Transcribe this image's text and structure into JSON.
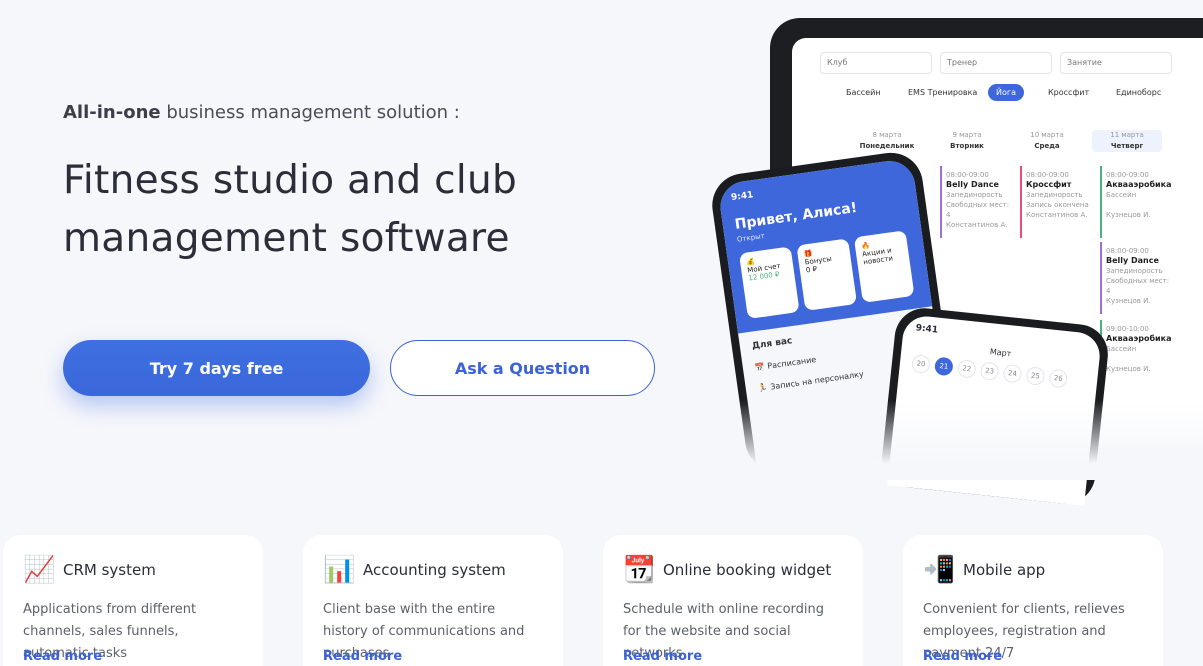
{
  "hero": {
    "eyebrow_bold": "All-in-one",
    "eyebrow_rest": " business management solution :",
    "headline_line1": "Fitness studio and club",
    "headline_line2": "management software",
    "primary_cta": "Try 7 days free",
    "secondary_cta": "Ask a Question"
  },
  "tablet": {
    "selects": [
      "Клуб",
      "Тренер",
      "Занятие"
    ],
    "chips": [
      "Бассейн",
      "EMS Тренировка",
      "Йога",
      "Кроссфит",
      "Единоборс"
    ],
    "active_chip": "Йога",
    "days": [
      {
        "date": "8 марта",
        "name": "Понедельник"
      },
      {
        "date": "9 марта",
        "name": "Вторник"
      },
      {
        "date": "10 марта",
        "name": "Среда"
      },
      {
        "date": "11 марта",
        "name": "Четверг"
      }
    ],
    "cards": [
      {
        "time": "08:00-09:00",
        "title": "Belly Dance",
        "sub1": "Запединорость",
        "sub2": "Свободных мест: 4",
        "coach": "Константинов А."
      },
      {
        "time": "08:00-09:00",
        "title": "Кроссфит",
        "sub1": "Запединорость",
        "sub2": "Запись окончена",
        "coach": "Константинов А."
      },
      {
        "time": "08:00-09:00",
        "title": "Аквааэробика",
        "sub1": "Бассейн",
        "sub2": "",
        "coach": "Кузнецов И."
      },
      {
        "time": "08:00-09:00",
        "title": "Belly Dance",
        "sub1": "Запединорость",
        "sub2": "Свободных мест: 4",
        "coach": "Кузнецов И."
      },
      {
        "time": "09:00-10:00",
        "title": "Аквааэробика",
        "sub1": "Бассейн",
        "sub2": "",
        "coach": "Кузнецов И."
      }
    ]
  },
  "phone1": {
    "time": "9:41",
    "greeting": "Привет, Алиса!",
    "status": "Открыт",
    "tiles": [
      {
        "label": "Мой счет",
        "value": "12 000 ₽"
      },
      {
        "label": "Бонусы",
        "value": "0 ₽"
      },
      {
        "label": "Акции и новости",
        "value": ""
      }
    ],
    "section": "Для вас",
    "items": [
      "Расписание",
      "Запись на персоналку"
    ]
  },
  "phone2": {
    "time": "9:41",
    "month": "Март",
    "dates": [
      "20",
      "21",
      "22",
      "23",
      "24",
      "25",
      "26"
    ],
    "selected": "21"
  },
  "features": [
    {
      "icon": "chart-up-icon",
      "glyph": "📈",
      "title": "CRM system",
      "desc": "Applications from different channels, sales funnels, automatic tasks",
      "link": "Read more"
    },
    {
      "icon": "bar-chart-icon",
      "glyph": "📊",
      "title": "Accounting system",
      "desc": "Client base with the entire history of communications and purchases",
      "link": "Read more"
    },
    {
      "icon": "calendar-icon",
      "glyph": "📆",
      "title": "Online booking widget",
      "desc": "Schedule with online recording for the website and social networks",
      "link": "Read more"
    },
    {
      "icon": "mobile-app-icon",
      "glyph": "📲",
      "title": "Mobile app",
      "desc": "Convenient for clients, relieves employees, registration and payment 24/7",
      "link": "Read more"
    }
  ],
  "colors": {
    "accent": "#3e67dc",
    "background": "#f6f7fb",
    "text": "#2b2e38"
  }
}
